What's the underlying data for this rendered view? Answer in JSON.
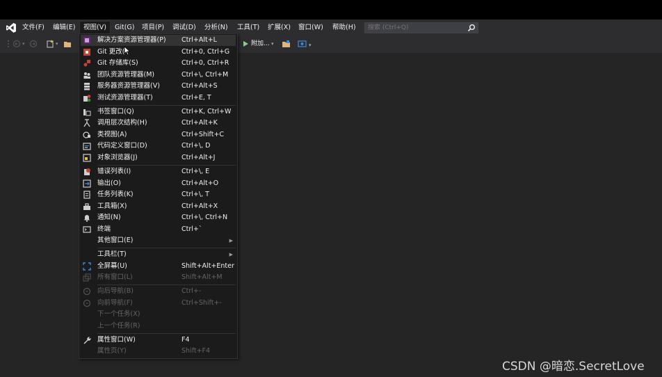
{
  "menubar": {
    "items": [
      "文件(F)",
      "编辑(E)",
      "视图(V)",
      "Git(G)",
      "项目(P)",
      "调试(D)",
      "分析(N)",
      "工具(T)",
      "扩展(X)",
      "窗口(W)",
      "帮助(H)"
    ],
    "search_placeholder": "搜索 (Ctrl+Q)"
  },
  "toolbar": {
    "attach_label": "附加..."
  },
  "view_menu": {
    "items": [
      {
        "label": "解决方案资源管理器(P)",
        "shortcut": "Ctrl+Alt+L",
        "icon": "solution-explorer-icon"
      },
      {
        "label": "Git 更改(",
        "shortcut": "Ctrl+0, Ctrl+G",
        "icon": "git-changes-icon"
      },
      {
        "label": "Git 存储库(S)",
        "shortcut": "Ctrl+0, Ctrl+R",
        "icon": "git-repository-icon"
      },
      {
        "label": "团队资源管理器(M)",
        "shortcut": "Ctrl+\\, Ctrl+M",
        "icon": "team-explorer-icon"
      },
      {
        "label": "服务器资源管理器(V)",
        "shortcut": "Ctrl+Alt+S",
        "icon": "server-explorer-icon"
      },
      {
        "label": "测试资源管理器(T)",
        "shortcut": "Ctrl+E, T",
        "icon": "test-explorer-icon"
      },
      {
        "label": "书签窗口(Q)",
        "shortcut": "Ctrl+K, Ctrl+W",
        "icon": "bookmark-icon"
      },
      {
        "label": "调用层次结构(H)",
        "shortcut": "Ctrl+Alt+K",
        "icon": "call-hierarchy-icon"
      },
      {
        "label": "类视图(A)",
        "shortcut": "Ctrl+Shift+C",
        "icon": "class-view-icon"
      },
      {
        "label": "代码定义窗口(D)",
        "shortcut": "Ctrl+\\, D",
        "icon": "code-definition-icon"
      },
      {
        "label": "对象浏览器(J)",
        "shortcut": "Ctrl+Alt+J",
        "icon": "object-browser-icon"
      },
      {
        "label": "错误列表(I)",
        "shortcut": "Ctrl+\\, E",
        "icon": "error-list-icon"
      },
      {
        "label": "输出(O)",
        "shortcut": "Ctrl+Alt+O",
        "icon": "output-icon"
      },
      {
        "label": "任务列表(K)",
        "shortcut": "Ctrl+\\, T",
        "icon": "task-list-icon"
      },
      {
        "label": "工具箱(X)",
        "shortcut": "Ctrl+Alt+X",
        "icon": "toolbox-icon"
      },
      {
        "label": "通知(N)",
        "shortcut": "Ctrl+\\, Ctrl+N",
        "icon": "notification-bell-icon"
      },
      {
        "label": "终端",
        "shortcut": "Ctrl+`",
        "icon": "terminal-icon"
      },
      {
        "label": "其他窗口(E)",
        "shortcut": "",
        "icon": "",
        "submenu": true
      },
      {
        "label": "工具栏(T)",
        "shortcut": "",
        "icon": "",
        "submenu": true
      },
      {
        "label": "全屏幕(U)",
        "shortcut": "Shift+Alt+Enter",
        "icon": "fullscreen-icon"
      },
      {
        "label": "所有窗口(L)",
        "shortcut": "Shift+Alt+M",
        "icon": "all-windows-icon",
        "disabled": true
      },
      {
        "label": "向后导航(B)",
        "shortcut": "Ctrl+-",
        "icon": "navigate-back-icon",
        "disabled": true
      },
      {
        "label": "向前导航(F)",
        "shortcut": "Ctrl+Shift+-",
        "icon": "navigate-forward-icon",
        "disabled": true
      },
      {
        "label": "下一个任务(X)",
        "shortcut": "",
        "icon": "",
        "disabled": true
      },
      {
        "label": "上一个任务(R)",
        "shortcut": "",
        "icon": "",
        "disabled": true
      },
      {
        "label": "属性窗口(W)",
        "shortcut": "F4",
        "icon": "properties-wrench-icon"
      },
      {
        "label": "属性页(Y)",
        "shortcut": "Shift+F4",
        "icon": "",
        "disabled": true
      }
    ]
  },
  "watermark": "CSDN @暗恋.SecretLove",
  "colors": {
    "background": "#2d2d30",
    "menu_bg": "#1b1b1c",
    "highlight": "#333334",
    "disabled": "#656565",
    "vs_purple": "#68217a"
  }
}
